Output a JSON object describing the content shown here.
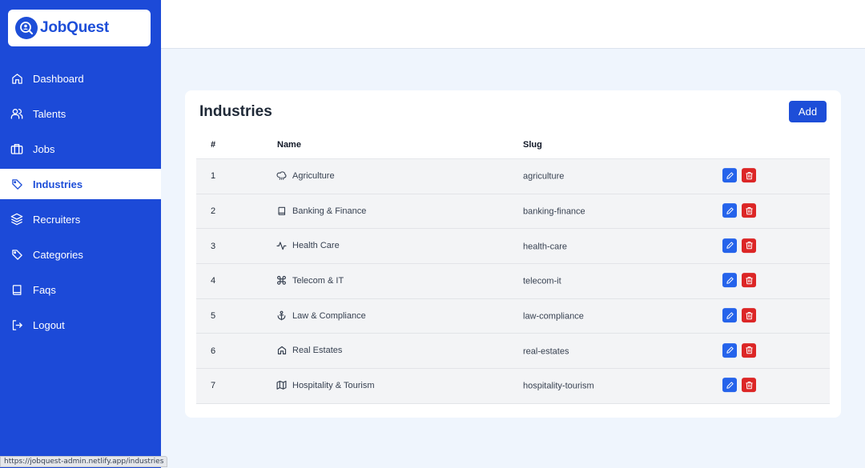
{
  "brand": {
    "name": "JobQuest",
    "accent": "#1d4ed8"
  },
  "sidebar": {
    "items": [
      {
        "label": "Dashboard",
        "icon": "home-icon"
      },
      {
        "label": "Talents",
        "icon": "users-icon"
      },
      {
        "label": "Jobs",
        "icon": "briefcase-icon"
      },
      {
        "label": "Industries",
        "icon": "tag-icon",
        "active": true
      },
      {
        "label": "Recruiters",
        "icon": "layers-icon"
      },
      {
        "label": "Categories",
        "icon": "tag-icon"
      },
      {
        "label": "Faqs",
        "icon": "book-icon"
      },
      {
        "label": "Logout",
        "icon": "logout-icon"
      }
    ]
  },
  "page": {
    "title": "Industries",
    "add_label": "Add"
  },
  "table": {
    "headers": {
      "num": "#",
      "name": "Name",
      "slug": "Slug"
    },
    "rows": [
      {
        "num": "1",
        "name": "Agriculture",
        "slug": "agriculture",
        "icon": "cloud-rain-icon"
      },
      {
        "num": "2",
        "name": "Banking & Finance",
        "slug": "banking-finance",
        "icon": "book-icon"
      },
      {
        "num": "3",
        "name": "Health Care",
        "slug": "health-care",
        "icon": "activity-icon"
      },
      {
        "num": "4",
        "name": "Telecom & IT",
        "slug": "telecom-it",
        "icon": "command-icon"
      },
      {
        "num": "5",
        "name": "Law & Compliance",
        "slug": "law-compliance",
        "icon": "anchor-icon"
      },
      {
        "num": "6",
        "name": "Real Estates",
        "slug": "real-estates",
        "icon": "home-icon"
      },
      {
        "num": "7",
        "name": "Hospitality & Tourism",
        "slug": "hospitality-tourism",
        "icon": "map-icon"
      }
    ]
  },
  "status_bar": {
    "url": "https://jobquest-admin.netlify.app/industries"
  },
  "colors": {
    "sidebar": "#1c4ad8",
    "background": "#eff5fd",
    "edit": "#2563eb",
    "delete": "#dc2626"
  }
}
